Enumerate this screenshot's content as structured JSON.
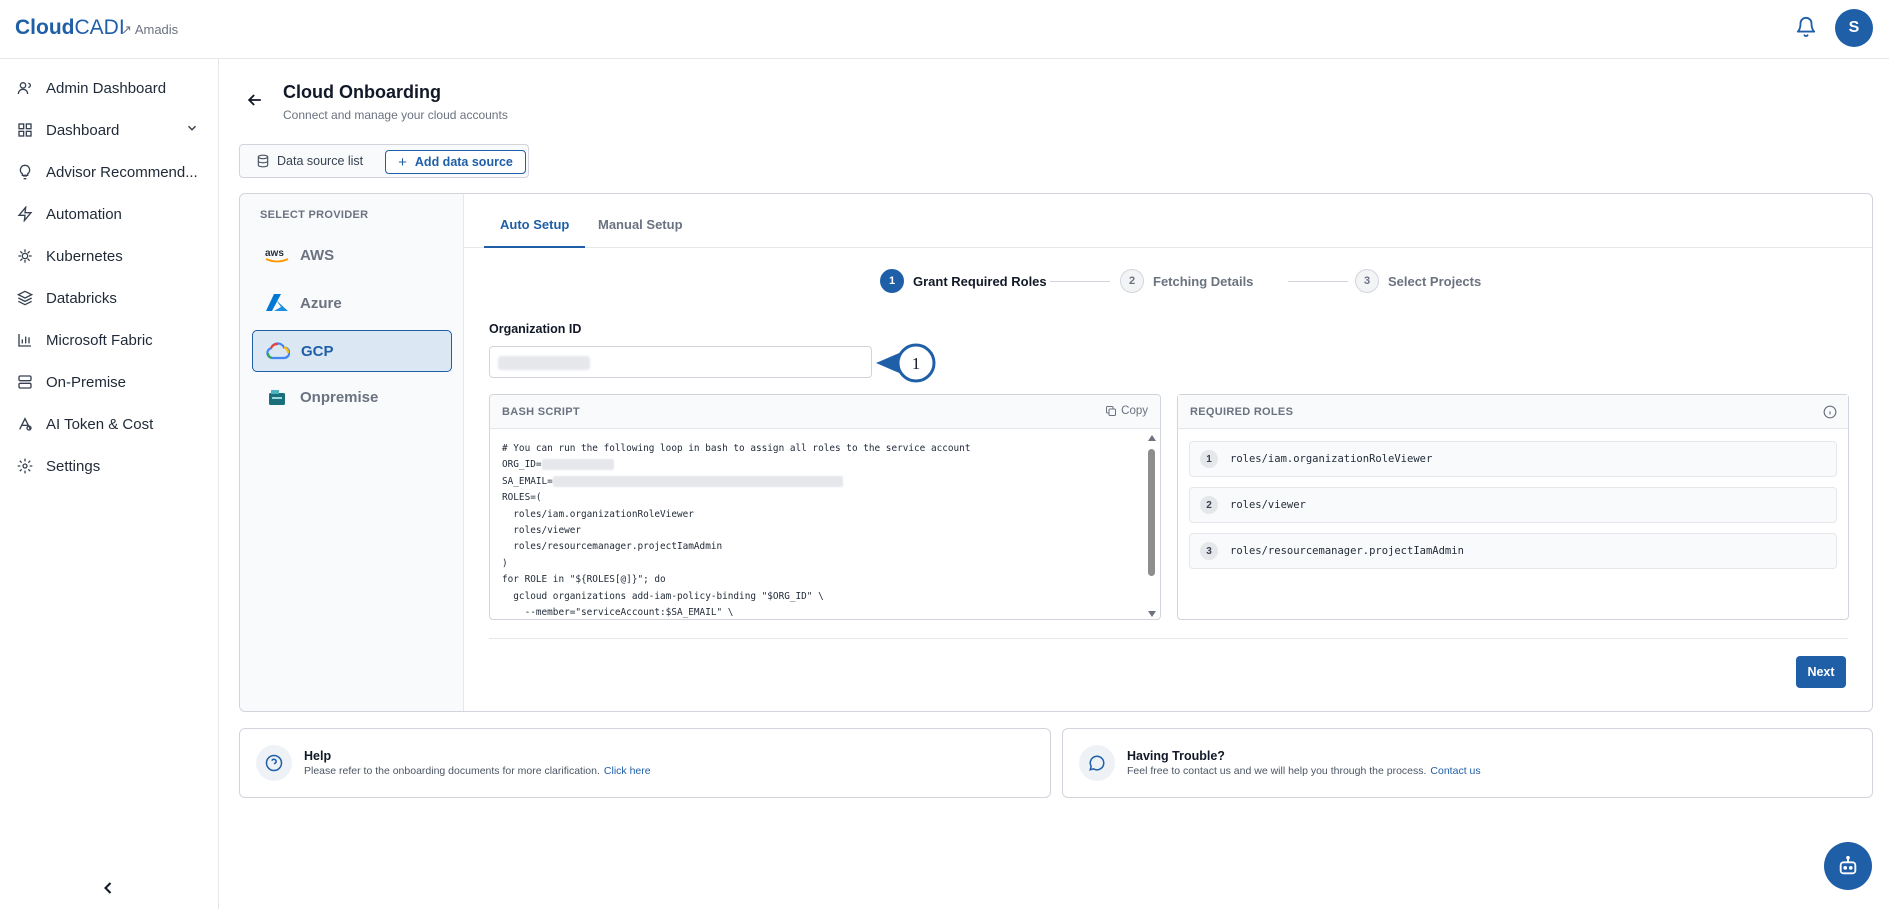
{
  "header": {
    "logo_bold": "Cloud",
    "logo_light": "CADI",
    "org_name": "Amadis",
    "avatar_initial": "S"
  },
  "sidebar": {
    "items": [
      {
        "label": "Admin Dashboard",
        "icon": "users-icon"
      },
      {
        "label": "Dashboard",
        "icon": "grid-icon"
      },
      {
        "label": "Advisor Recommend...",
        "icon": "lightbulb-icon"
      },
      {
        "label": "Automation",
        "icon": "bolt-icon"
      },
      {
        "label": "Kubernetes",
        "icon": "helm-icon"
      },
      {
        "label": "Databricks",
        "icon": "layers-icon"
      },
      {
        "label": "Microsoft Fabric",
        "icon": "bar-chart-icon"
      },
      {
        "label": "On-Premise",
        "icon": "server-icon"
      },
      {
        "label": "AI Token & Cost",
        "icon": "ai-token-icon"
      },
      {
        "label": "Settings",
        "icon": "gear-icon"
      }
    ]
  },
  "page": {
    "title": "Cloud Onboarding",
    "subtitle": "Connect and manage your cloud accounts",
    "ds_list_label": "Data source list",
    "ds_add_label": "Add data source"
  },
  "providers": {
    "heading": "SELECT PROVIDER",
    "items": [
      {
        "label": "AWS",
        "icon": "aws-icon"
      },
      {
        "label": "Azure",
        "icon": "azure-icon"
      },
      {
        "label": "GCP",
        "icon": "gcp-icon",
        "active": true
      },
      {
        "label": "Onpremise",
        "icon": "onpremise-icon"
      }
    ]
  },
  "tabs": [
    {
      "label": "Auto Setup",
      "active": true
    },
    {
      "label": "Manual Setup"
    }
  ],
  "steps": [
    {
      "num": "1",
      "label": "Grant Required Roles",
      "active": true
    },
    {
      "num": "2",
      "label": "Fetching Details"
    },
    {
      "num": "3",
      "label": "Select Projects"
    }
  ],
  "form": {
    "org_label": "Organization ID",
    "marker": "1"
  },
  "script": {
    "title": "BASH SCRIPT",
    "copy_label": "Copy",
    "lines": [
      "# You can run the following loop in bash to assign all roles to the service account",
      "ORG_ID=",
      "SA_EMAIL=",
      "ROLES=(",
      "  roles/iam.organizationRoleViewer",
      "  roles/viewer",
      "  roles/resourcemanager.projectIamAdmin",
      ")",
      "for ROLE in \"${ROLES[@]}\"; do",
      "  gcloud organizations add-iam-policy-binding \"$ORG_ID\" \\",
      "    --member=\"serviceAccount:$SA_EMAIL\" \\"
    ]
  },
  "roles": {
    "title": "REQUIRED ROLES",
    "items": [
      {
        "num": "1",
        "name": "roles/iam.organizationRoleViewer"
      },
      {
        "num": "2",
        "name": "roles/viewer"
      },
      {
        "num": "3",
        "name": "roles/resourcemanager.projectIamAdmin"
      }
    ]
  },
  "actions": {
    "next_label": "Next"
  },
  "help": {
    "title": "Help",
    "text": "Please refer to the onboarding documents for more clarification.",
    "link": "Click here"
  },
  "trouble": {
    "title": "Having Trouble?",
    "text": "Feel free to contact us and we will help you through the process.",
    "link": "Contact us"
  },
  "colors": {
    "accent": "#1f5fa8",
    "gcp_red": "#ea4335",
    "gcp_blue": "#4285f4",
    "gcp_yellow": "#fbbc05",
    "gcp_green": "#34a853",
    "aws_orange": "#ff9900",
    "azure_blue": "#0078d4"
  }
}
